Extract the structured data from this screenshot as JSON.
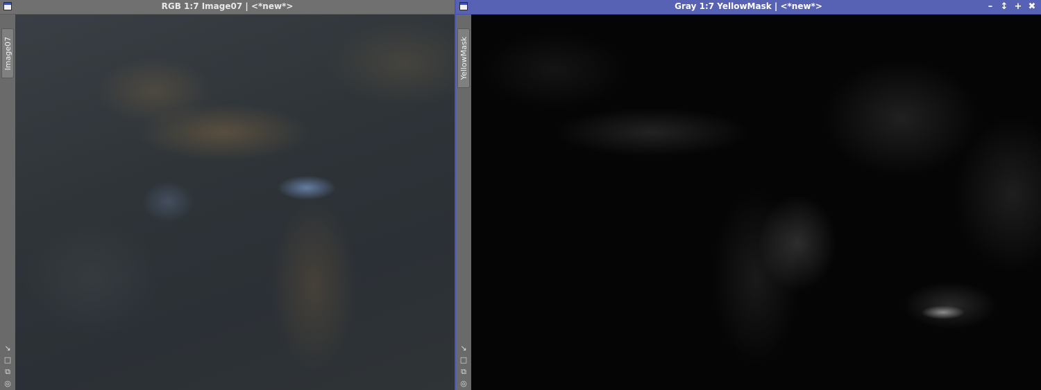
{
  "windows": [
    {
      "title": "RGB 1:7 Image07 | <*new*>",
      "tab_label": "Image07",
      "active": false,
      "image_type": "color nebula image"
    },
    {
      "title": "Gray 1:7 YellowMask | <*new*>",
      "tab_label": "YellowMask",
      "active": true,
      "image_type": "grayscale mask"
    }
  ],
  "window_controls": {
    "minimize": "–",
    "shade": "↕",
    "maximize": "+",
    "close": "✖"
  },
  "side_icons": [
    "arrow-diagonal-icon",
    "fit-icon",
    "clone-icon",
    "target-icon"
  ],
  "colors": {
    "active_title_bg": "#5762b5",
    "inactive_title_bg": "#707070",
    "workspace_bg": "#5a5a5a"
  }
}
